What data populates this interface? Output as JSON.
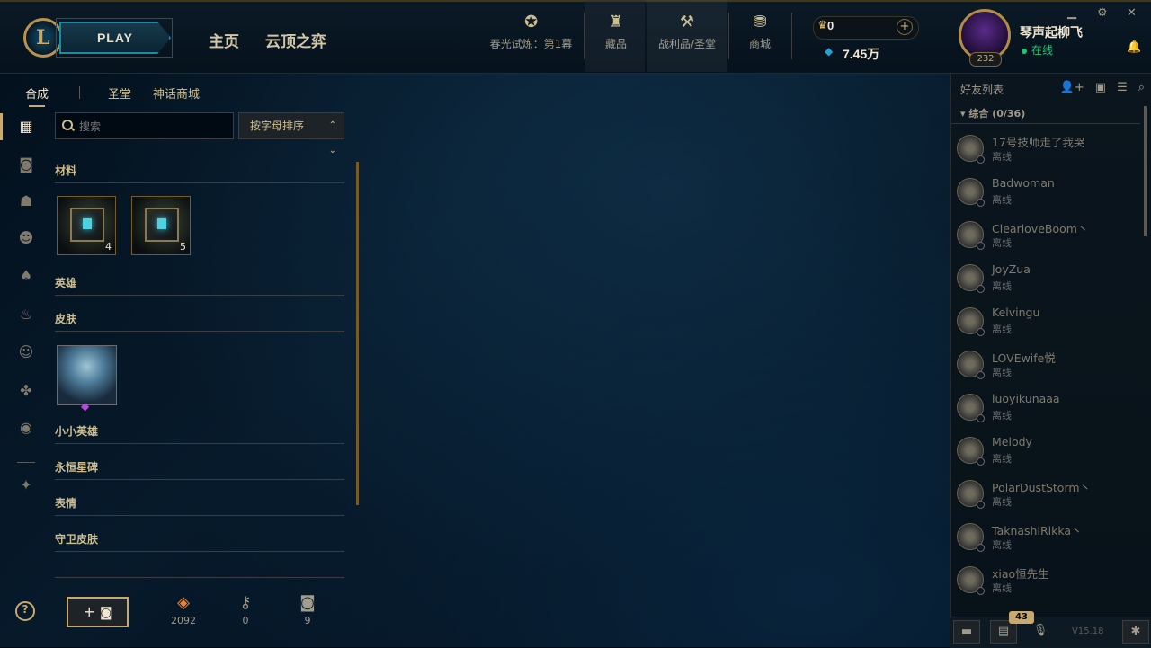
{
  "topbar": {
    "logo_letter": "L",
    "play_label": "PLAY",
    "nav": [
      "主页",
      "云顶之弈"
    ],
    "icons": [
      {
        "label": "春光试炼：第1幕",
        "icon": "event-crest-icon"
      },
      {
        "label": "藏品",
        "icon": "collection-bag-icon"
      },
      {
        "label": "战利品/圣堂",
        "icon": "loot-hammer-icon"
      },
      {
        "label": "商城",
        "icon": "store-coins-icon"
      }
    ],
    "rp_value": "0",
    "be_value": "7.45万",
    "summoner_name": "琴声起柳飞",
    "status": "在线",
    "level": "232"
  },
  "left": {
    "subtabs": [
      "合成",
      "圣堂",
      "神话商城"
    ],
    "search_placeholder": "搜索",
    "sort_label": "按字母排序",
    "sections": {
      "materials": "材料",
      "champions": "英雄",
      "skins": "皮肤",
      "little_legends": "小小英雄",
      "eternals": "永恒星碑",
      "emotes": "表情",
      "ward_skins": "守卫皮肤"
    },
    "material_counts": [
      "4",
      "5"
    ],
    "help": "?",
    "craft_label": "+",
    "resources": [
      {
        "icon": "orange-essence-icon",
        "value": "2092"
      },
      {
        "icon": "key-icon",
        "value": "0"
      },
      {
        "icon": "chest-icon",
        "value": "9"
      }
    ]
  },
  "friends": {
    "title": "好友列表",
    "group": "综合 (0/36)",
    "list": [
      {
        "name": "17号技师走了我哭",
        "status": "离线"
      },
      {
        "name": "Badwoman",
        "status": "离线"
      },
      {
        "name": "ClearloveBoom丶",
        "status": "离线"
      },
      {
        "name": "JoyZua",
        "status": "离线"
      },
      {
        "name": "Kelvingu",
        "status": "离线"
      },
      {
        "name": "LOVEwife悦",
        "status": "离线"
      },
      {
        "name": "luoyikunaaa",
        "status": "离线"
      },
      {
        "name": "Melody",
        "status": "离线"
      },
      {
        "name": "PolarDustStorm丶",
        "status": "离线"
      },
      {
        "name": "TaknashiRikka丶",
        "status": "离线"
      },
      {
        "name": "xiao恒先生",
        "status": "离线"
      }
    ],
    "badge": "43",
    "version": "V15.18"
  },
  "colors": {
    "gold": "#c8aa6e",
    "online": "#1ec776",
    "teal": "#1e8ba3"
  }
}
